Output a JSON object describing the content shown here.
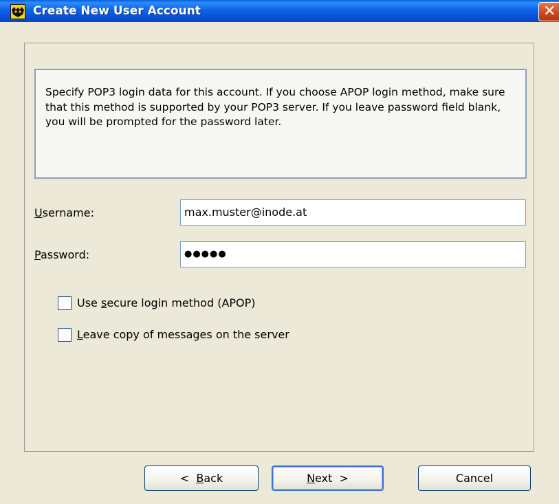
{
  "window": {
    "title": "Create New User Account",
    "close_glyph": "✕",
    "app_icon": "bat-icon"
  },
  "info": {
    "text": "Specify POP3 login data for this account. If you choose APOP login method, make sure that this method is supported by your POP3 server. If you leave password field blank, you will be prompted for the password later."
  },
  "form": {
    "username_label_mnemonic": "U",
    "username_label_rest": "sername:",
    "username_value": "max.muster@inode.at",
    "password_label_mnemonic": "P",
    "password_label_rest": "assword:",
    "password_value": "●●●●●",
    "apop_label_pre": "Use ",
    "apop_label_mnemonic": "s",
    "apop_label_rest": "ecure login method (APOP)",
    "apop_checked": false,
    "leave_copy_label_mnemonic": "L",
    "leave_copy_label_rest": "eave copy of messages on the server",
    "leave_copy_checked": false
  },
  "buttons": {
    "back_prefix": "<  ",
    "back_mnemonic": "B",
    "back_rest": "ack",
    "next_mnemonic": "N",
    "next_rest": "ext  >",
    "cancel": "Cancel"
  },
  "colors": {
    "titlebar": "#0a5fe0",
    "close": "#d24a1c",
    "dialog_bg": "#ece9d8",
    "field_border": "#7f9db9"
  }
}
